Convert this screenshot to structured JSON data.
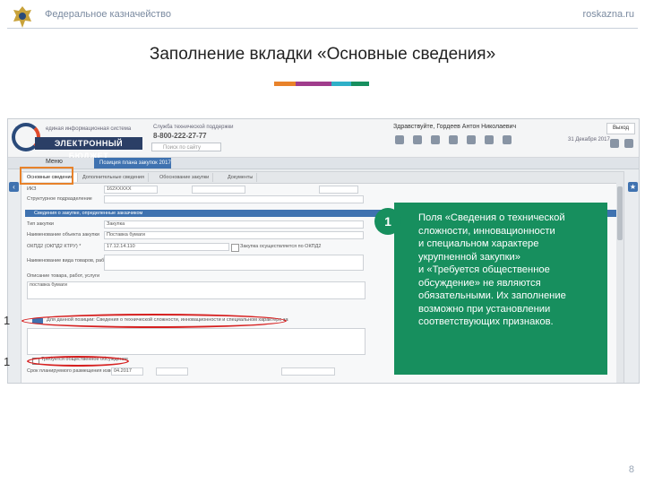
{
  "header": {
    "org": "Федеральное казначейство",
    "site": "roskazna.ru",
    "title": "Заполнение вкладки «Основные сведения»"
  },
  "colors": {
    "green": "#178f5e",
    "orange": "#e8822a",
    "purple": "#a03c8c",
    "teal": "#2fb0c8",
    "red": "#d62020",
    "blue": "#3f72b0"
  },
  "screenshot": {
    "logo_small": "единая информационная система",
    "logo_main": "ЭЛЕКТРОННЫЙ БЮДЖЕТ",
    "support_label": "Служба технической поддержки",
    "phone": "8-800-222-27-77",
    "search_placeholder": "Поиск по сайту",
    "user": "Здравствуйте, Гордеев Антон Николаевич",
    "exit": "Выход",
    "date": "31 Декабря 2017",
    "menu": "Меню",
    "open_tab": "Позиция плана закупок 2017",
    "form_tabs": [
      "Основные сведения",
      "Дополнительные сведения",
      "Обоснование закупки",
      "Документы"
    ],
    "fields": [
      {
        "label": "ИКЗ",
        "value": "162XXXXX"
      },
      {
        "label": "Структурное подразделение",
        "value": ""
      },
      {
        "label": "Тип закупки",
        "value": "Закупка"
      },
      {
        "label": "Наименование объекта закупки",
        "value": "Поставка бумаги"
      },
      {
        "label": "ОКПД2 (ОКПД2 КТРУ) *",
        "value": "17.12.14.110"
      },
      {
        "label": "Наименование вида товаров, работ, услуг",
        "value": ""
      },
      {
        "label": "Описание товара, работ, услуги",
        "value": "поставка бумаги"
      },
      {
        "label": "Срок планируемого размещения извещения",
        "value": "04.2017"
      }
    ],
    "section": "Сведения о закупке, определенные заказчиком",
    "ovz_check": "Закупка осуществляется по ОКПД2",
    "row1_text": "Для данной позиции: Сведения о технической сложности, инновационности и специальном характере закупки",
    "row2_text": "Требуется общественное обсуждение"
  },
  "markers": {
    "m1": "1",
    "m2": "1",
    "m3": "1"
  },
  "callout": {
    "number": "1",
    "text": "Поля «Сведения о технической\nсложности, инновационности\nи специальном характере\nукрупненной закупки»\nи «Требуется общественное\nобсуждение» не являются\nобязательными. Их заполнение\nвозможно при установлении\nсоответствующих признаков."
  },
  "page_number": "8"
}
